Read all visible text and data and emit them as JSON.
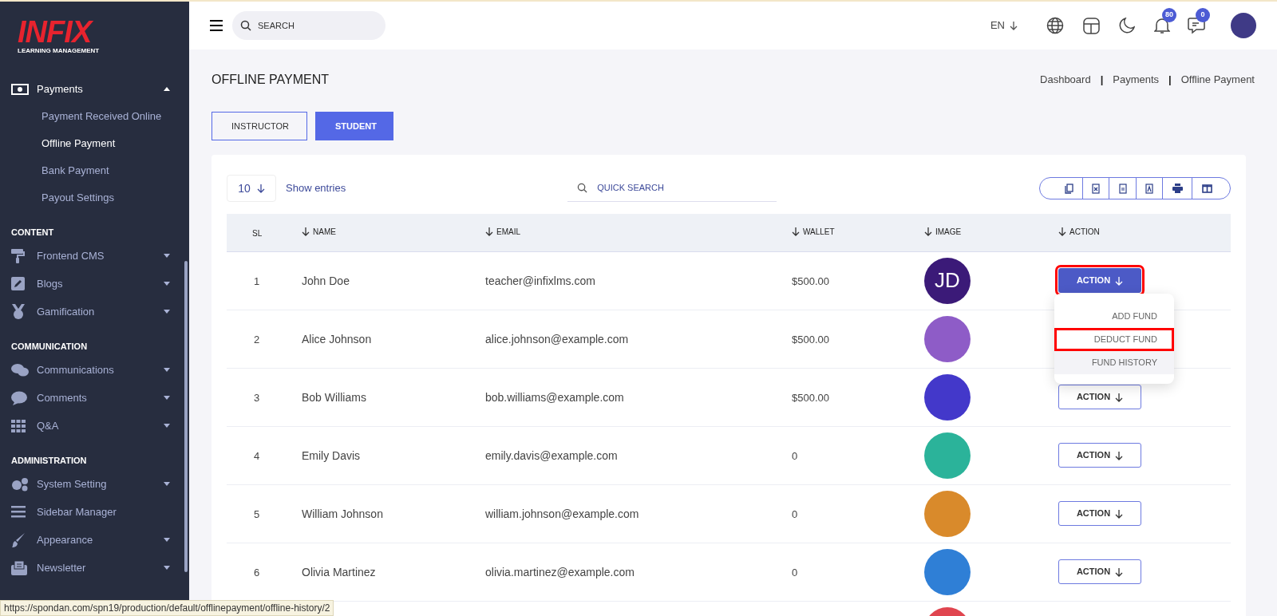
{
  "brand": {
    "logo": "INFIX",
    "tagline": "LEARNING MANAGEMENT"
  },
  "sidebar": {
    "sections": [
      {
        "items": [
          {
            "label": "Payments",
            "expanded": true,
            "children": [
              {
                "label": "Payment Received Online",
                "selected": false
              },
              {
                "label": "Offline Payment",
                "selected": true
              },
              {
                "label": "Bank Payment",
                "selected": false
              },
              {
                "label": "Payout Settings",
                "selected": false
              }
            ]
          }
        ]
      },
      {
        "title": "CONTENT",
        "items": [
          {
            "label": "Frontend CMS",
            "expanded": false
          },
          {
            "label": "Blogs",
            "expanded": false
          },
          {
            "label": "Gamification",
            "expanded": false
          }
        ]
      },
      {
        "title": "COMMUNICATION",
        "items": [
          {
            "label": "Communications",
            "expanded": false
          },
          {
            "label": "Comments",
            "expanded": false
          },
          {
            "label": "Q&A",
            "expanded": false
          }
        ]
      },
      {
        "title": "ADMINISTRATION",
        "items": [
          {
            "label": "System Setting",
            "expanded": false
          },
          {
            "label": "Sidebar Manager"
          },
          {
            "label": "Appearance",
            "expanded": false
          },
          {
            "label": "Newsletter",
            "expanded": false
          }
        ]
      }
    ]
  },
  "header": {
    "search_placeholder": "SEARCH",
    "language": "EN",
    "notifications": "80",
    "messages": "0"
  },
  "page": {
    "title": "OFFLINE PAYMENT",
    "breadcrumbs": [
      {
        "kind": "link",
        "text": "Dashboard"
      },
      {
        "kind": "separator",
        "text": "|"
      },
      {
        "kind": "link",
        "text": "Payments"
      },
      {
        "kind": "separator",
        "text": "|"
      },
      {
        "kind": "link",
        "text": "Offline Payment"
      }
    ]
  },
  "tabs": [
    {
      "label": "INSTRUCTOR",
      "selected": false
    },
    {
      "label": "STUDENT",
      "selected": true
    }
  ],
  "table_controls": {
    "page_size": "10",
    "show_entries": "Show entries",
    "search_placeholder": "QUICK SEARCH"
  },
  "table": {
    "columns": [
      "SL",
      "NAME",
      "EMAIL",
      "WALLET",
      "IMAGE",
      "ACTION"
    ],
    "rows": [
      {
        "sl": "1",
        "name": "John Doe",
        "email": "teacher@infixlms.com",
        "wallet": "$500.00",
        "image": {
          "kind": "initials",
          "text": "JD",
          "color": "#3b1a78"
        },
        "action": {
          "label": "ACTION",
          "open": true,
          "highlighted": true
        }
      },
      {
        "sl": "2",
        "name": "Alice Johnson",
        "email": "alice.johnson@example.com",
        "wallet": "$500.00",
        "image": {
          "kind": "photo",
          "color": "#8e5cc7"
        }
      },
      {
        "sl": "3",
        "name": "Bob Williams",
        "email": "bob.williams@example.com",
        "wallet": "$500.00",
        "image": {
          "kind": "photo",
          "color": "#4338ca"
        },
        "action": {
          "label": "ACTION",
          "open": false,
          "highlighted": false
        }
      },
      {
        "sl": "4",
        "name": "Emily Davis",
        "email": "emily.davis@example.com",
        "wallet": "0",
        "image": {
          "kind": "photo",
          "color": "#2bb39a"
        },
        "action": {
          "label": "ACTION",
          "open": false,
          "highlighted": false
        }
      },
      {
        "sl": "5",
        "name": "William Johnson",
        "email": "william.johnson@example.com",
        "wallet": "0",
        "image": {
          "kind": "photo",
          "color": "#d98a2b"
        },
        "action": {
          "label": "ACTION",
          "open": false,
          "highlighted": false
        }
      },
      {
        "sl": "6",
        "name": "Olivia Martinez",
        "email": "olivia.martinez@example.com",
        "wallet": "0",
        "image": {
          "kind": "photo",
          "color": "#2f7fd6"
        },
        "action": {
          "label": "ACTION",
          "open": false,
          "highlighted": false
        }
      },
      {
        "image": {
          "kind": "photo",
          "color": "#e0454f"
        }
      }
    ]
  },
  "action_menu": [
    {
      "label": "ADD FUND",
      "hovered": false,
      "highlighted": false
    },
    {
      "label": "DEDUCT FUND",
      "hovered": false,
      "highlighted": true
    },
    {
      "label": "FUND HISTORY",
      "hovered": true,
      "highlighted": false
    }
  ],
  "status_url": "https://spondan.com/spn19/production/default/offlinepayment/offline-history/2"
}
